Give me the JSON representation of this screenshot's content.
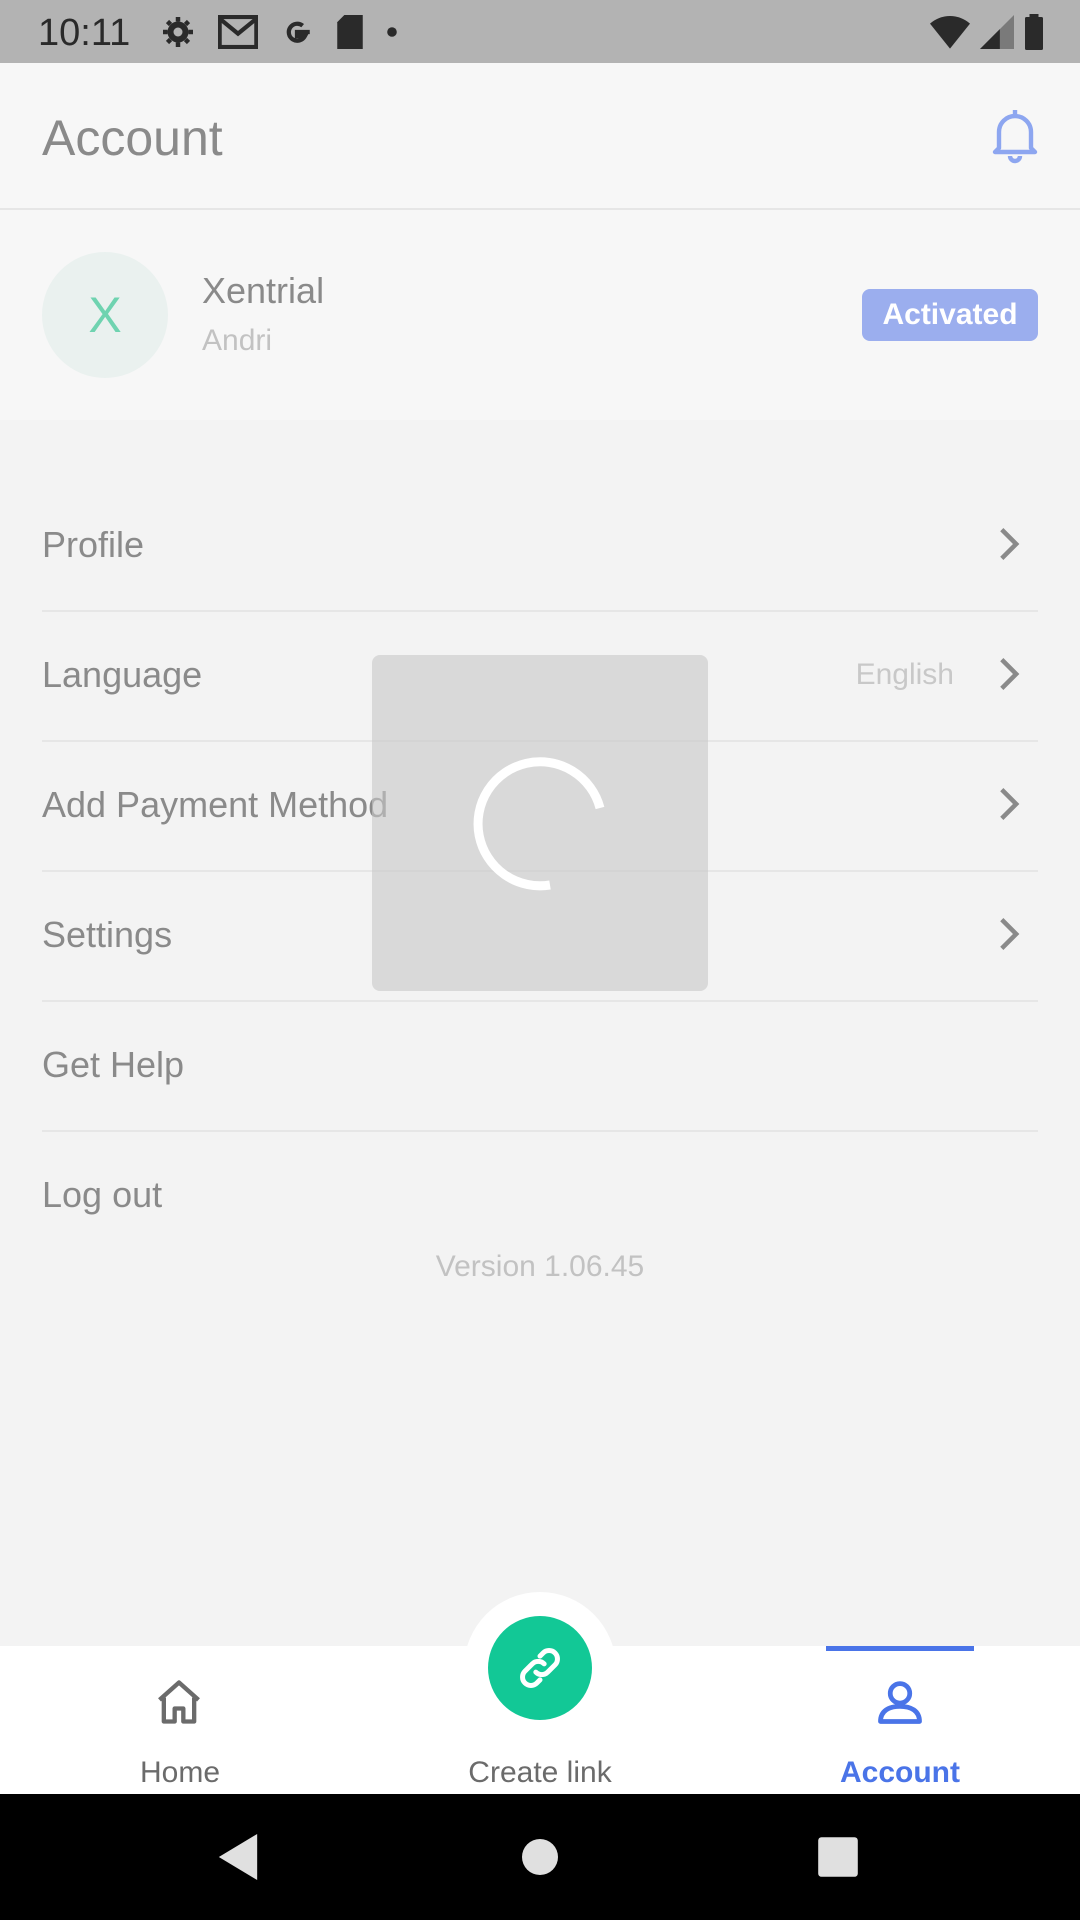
{
  "status_bar": {
    "time": "10:11"
  },
  "header": {
    "title": "Account"
  },
  "user": {
    "avatar_letter": "X",
    "name": "Xentrial",
    "subtitle": "Andri",
    "status_badge": "Activated"
  },
  "menu": {
    "items": [
      {
        "label": "Profile",
        "value": ""
      },
      {
        "label": "Language",
        "value": "English"
      },
      {
        "label": "Add Payment Method",
        "value": ""
      },
      {
        "label": "Settings",
        "value": ""
      },
      {
        "label": "Get Help",
        "value": ""
      },
      {
        "label": "Log out",
        "value": ""
      }
    ]
  },
  "version": "Version 1.06.45",
  "bottom_nav": {
    "home": "Home",
    "create": "Create link",
    "account": "Account"
  },
  "colors": {
    "accent": "#4a74e8",
    "fab": "#12c896",
    "badge": "#9baeee"
  },
  "icons": {
    "status": [
      "settings-icon",
      "gmail-icon",
      "google-icon",
      "sd-card-icon",
      "dot-icon",
      "wifi-icon",
      "signal-icon",
      "battery-icon"
    ],
    "header": "bell-icon",
    "nav": [
      "home-icon",
      "link-icon",
      "user-icon"
    ]
  }
}
